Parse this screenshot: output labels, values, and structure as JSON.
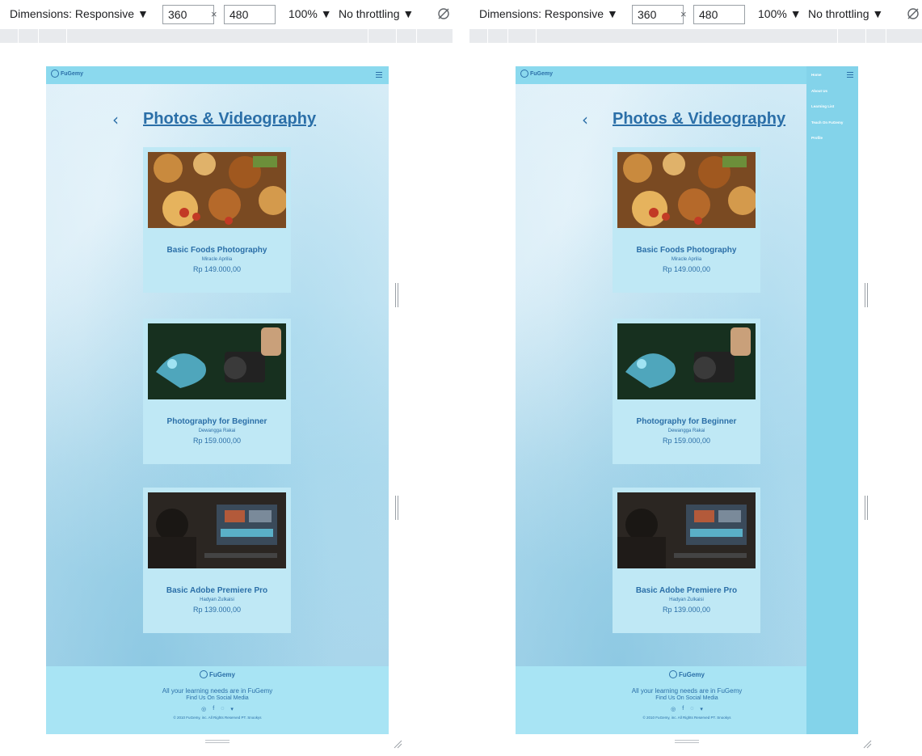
{
  "devtools": {
    "dimensions_label": "Dimensions: Responsive ▼",
    "width_value": "360",
    "times": "×",
    "height_value": "480",
    "zoom_label": "100% ▼",
    "throttle_label": "No throttling ▼",
    "rotate_icon": "rotate-icon"
  },
  "site": {
    "logo_text": "FuGemy",
    "page_title": "Photos & Videography",
    "back_glyph": "‹",
    "courses": [
      {
        "title": "Basic Foods Photography",
        "author": "Miracle Aprilia",
        "price": "Rp 149.000,00"
      },
      {
        "title": "Photography for Beginner",
        "author": "Dewangga Rakai",
        "price": "Rp 159.000,00"
      },
      {
        "title": "Basic Adobe Premiere Pro",
        "author": "Hadyan Zulkaisi",
        "price": "Rp 139.000,00"
      }
    ],
    "footer": {
      "tagline": "All your learning needs are in FuGemy",
      "find_us": "Find Us On Social Media",
      "copyright": "© 2010 FuGemy, inc. All Rights Reserved PT. Snookys"
    },
    "menu": [
      "Home",
      "About Us",
      "Learning List",
      "Teach On FuGemy",
      "Profile"
    ]
  },
  "colors": {
    "brand": "#2b6fa8",
    "nav": "#8bd9ee",
    "card": "#bfe8f5",
    "footer": "#a8e4f4",
    "menu": "#83d3ea"
  }
}
